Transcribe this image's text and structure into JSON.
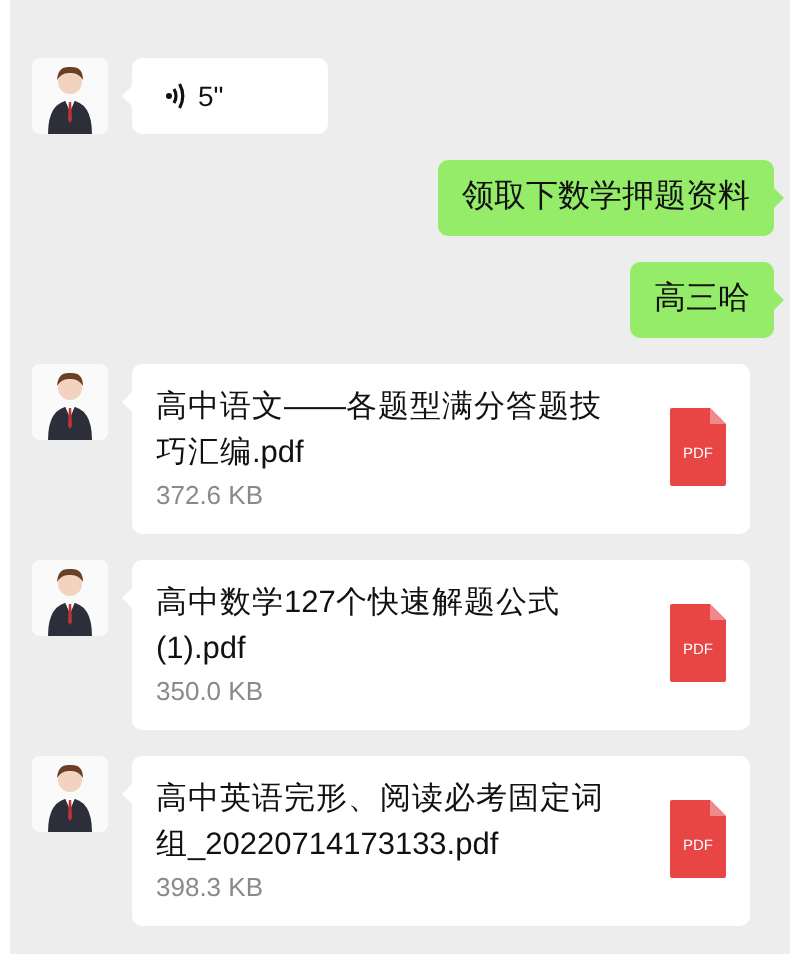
{
  "messages": [
    {
      "kind": "voice",
      "sent": false,
      "duration": "5\""
    },
    {
      "kind": "text",
      "sent": true,
      "text": "领取下数学押题资料"
    },
    {
      "kind": "text",
      "sent": true,
      "text": "高三哈"
    },
    {
      "kind": "file",
      "sent": false,
      "filename": "高中语文——各题型满分答题技巧汇编.pdf",
      "size": "372.6 KB",
      "file_type": "PDF"
    },
    {
      "kind": "file",
      "sent": false,
      "filename": "高中数学127个快速解题公式(1).pdf",
      "size": "350.0 KB",
      "file_type": "PDF"
    },
    {
      "kind": "file",
      "sent": false,
      "filename": "高中英语完形、阅读必考固定词组_20220714173133.pdf",
      "size": "398.3 KB",
      "file_type": "PDF"
    }
  ]
}
